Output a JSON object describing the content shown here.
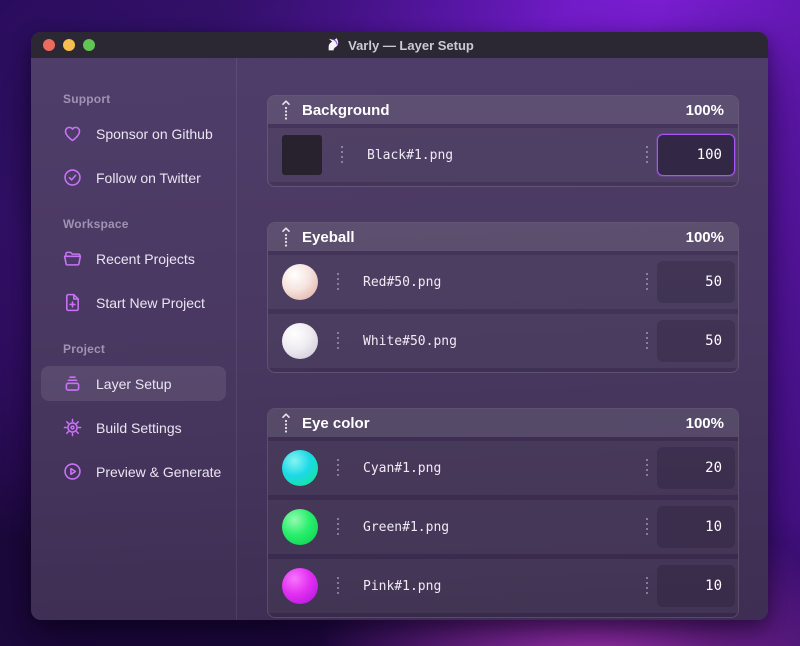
{
  "window": {
    "title": "Varly — Layer Setup",
    "app_icon": "unicorn-icon"
  },
  "colors": {
    "accent": "#c873f5",
    "focus_border": "#a855f7",
    "traffic_red": "#ed6a5e",
    "traffic_yellow": "#f5bf4f",
    "traffic_green": "#61c554"
  },
  "sidebar": {
    "sections": [
      {
        "label": "Support",
        "items": [
          {
            "label": "Sponsor on Github",
            "icon": "heart-icon",
            "selected": false
          },
          {
            "label": "Follow on Twitter",
            "icon": "badge-check-icon",
            "selected": false
          }
        ]
      },
      {
        "label": "Workspace",
        "items": [
          {
            "label": "Recent Projects",
            "icon": "folder-open-icon",
            "selected": false
          },
          {
            "label": "Start New Project",
            "icon": "file-plus-icon",
            "selected": false
          }
        ]
      },
      {
        "label": "Project",
        "items": [
          {
            "label": "Layer Setup",
            "icon": "layer-stack-icon",
            "selected": true
          },
          {
            "label": "Build Settings",
            "icon": "gear-icon",
            "selected": false
          },
          {
            "label": "Preview & Generate",
            "icon": "play-circle-icon",
            "selected": false
          }
        ]
      }
    ]
  },
  "groups": [
    {
      "title": "Background",
      "percent": "100%",
      "rows": [
        {
          "file": "Black#1.png",
          "value": "100",
          "focused": true,
          "thumb": {
            "shape": "square",
            "colors": [
              "#27222e"
            ]
          }
        }
      ]
    },
    {
      "title": "Eyeball",
      "percent": "100%",
      "rows": [
        {
          "file": "Red#50.png",
          "value": "50",
          "focused": false,
          "thumb": {
            "shape": "ball",
            "colors": [
              "#ffffff",
              "#f6e3de",
              "#dba69d"
            ]
          }
        },
        {
          "file": "White#50.png",
          "value": "50",
          "focused": false,
          "thumb": {
            "shape": "ball",
            "colors": [
              "#ffffff",
              "#efecf1",
              "#c8c1d1"
            ]
          }
        }
      ]
    },
    {
      "title": "Eye color",
      "percent": "100%",
      "rows": [
        {
          "file": "Cyan#1.png",
          "value": "20",
          "focused": false,
          "thumb": {
            "shape": "ball",
            "colors": [
              "#86f4f2",
              "#1bd9e6",
              "#13e87f"
            ]
          }
        },
        {
          "file": "Green#1.png",
          "value": "10",
          "focused": false,
          "thumb": {
            "shape": "ball",
            "colors": [
              "#93fab0",
              "#27ef6c",
              "#0ccb4c"
            ]
          }
        },
        {
          "file": "Pink#1.png",
          "value": "10",
          "focused": false,
          "thumb": {
            "shape": "ball",
            "colors": [
              "#f875fb",
              "#e230f2",
              "#a911d6"
            ]
          }
        }
      ]
    }
  ]
}
